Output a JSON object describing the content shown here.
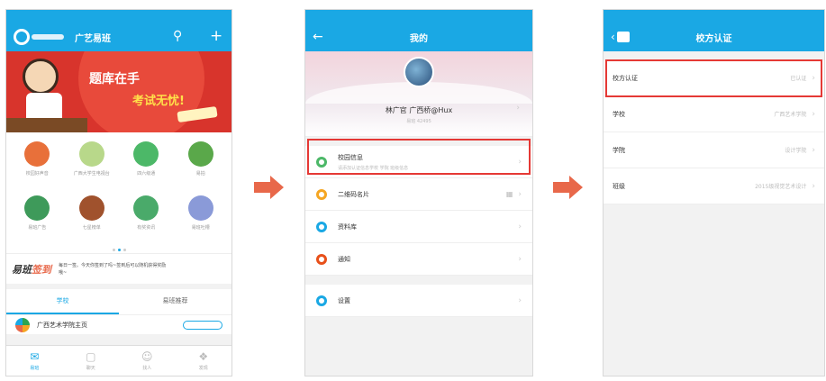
{
  "phone1": {
    "header": {
      "title": "广艺易班"
    },
    "banner": {
      "slogan_line1": "题库在手",
      "slogan_line2": "考试无忧!"
    },
    "grid": [
      {
        "label": "校园好声音",
        "color": "#e8703a"
      },
      {
        "label": "广西大学生电视台",
        "color": "#b8d88a"
      },
      {
        "label": "四六级通",
        "color": "#4cb868"
      },
      {
        "label": "易拍",
        "color": "#5aa84a"
      },
      {
        "label": "易班广告",
        "color": "#3e9a5a"
      },
      {
        "label": "七星榜单",
        "color": "#a0522d"
      },
      {
        "label": "有奖资讯",
        "color": "#4aaa6a"
      },
      {
        "label": "易班吐槽",
        "color": "#8a9ad8"
      }
    ],
    "checkin": {
      "title_a": "易班",
      "title_b": "签到",
      "text": "每日一签。今天你签到了吗~签到后可以随机获得奖励哦~"
    },
    "tabs": [
      "学校",
      "易班推荐"
    ],
    "school_row": {
      "name": "广西艺术学院主页"
    },
    "nav": [
      "易班",
      "聊天",
      "找人",
      "发现"
    ]
  },
  "phone2": {
    "header": {
      "title": "我的"
    },
    "profile": {
      "name": "林广官 广西桥@Hux",
      "id": "易班 42495"
    },
    "menu": [
      {
        "label": "校园信息",
        "sub": "请添加认证信息学校 学院 班级信息",
        "color": "#4cb868"
      },
      {
        "label": "二维码名片",
        "sub": "",
        "color": "#f5a623"
      },
      {
        "label": "资料库",
        "sub": "",
        "color": "#1aa8e4"
      },
      {
        "label": "通知",
        "sub": "",
        "color": "#e8501a"
      },
      {
        "label": "设置",
        "sub": "",
        "color": "#1aa8e4"
      }
    ]
  },
  "phone3": {
    "header": {
      "title": "校方认证"
    },
    "rows": [
      {
        "label": "校方认证",
        "value": "已认证"
      },
      {
        "label": "学校",
        "value": "广西艺术学院"
      },
      {
        "label": "学院",
        "value": "设计学院"
      },
      {
        "label": "班级",
        "value": "2015级视觉艺术设计"
      }
    ]
  }
}
